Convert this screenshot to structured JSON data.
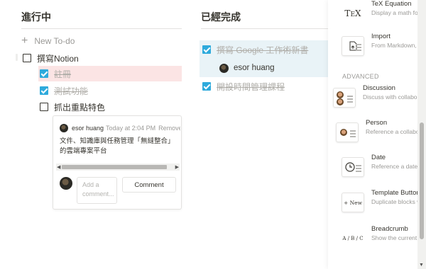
{
  "board": {
    "in_progress": {
      "title": "進行中",
      "new_todo": "New To-do",
      "items": [
        {
          "label": "撰寫Notion",
          "checked": false
        },
        {
          "label": "註冊",
          "checked": true
        },
        {
          "label": "測試功能",
          "checked": true
        },
        {
          "label": "抓出重點特色",
          "checked": false
        }
      ]
    },
    "completed": {
      "title": "已經完成",
      "items": [
        {
          "label": "撰寫 Google 工作術新書",
          "checked": true
        },
        {
          "label": "開設時間管理課程",
          "checked": true
        }
      ],
      "assignee": "esor huang"
    }
  },
  "comment": {
    "author": "esor huang",
    "time": "Today at 2:04 PM",
    "remove": "Remove",
    "text": "文件、知識庫與任務管理「無縫整合」的雲端專案平台",
    "input_placeholder": "Add a comment...",
    "button": "Comment"
  },
  "blocks_panel": {
    "section_advanced": "ADVANCED",
    "items": [
      {
        "title": "TeX Equation",
        "desc": "Display a math formula",
        "icon": "tex-icon",
        "glyph": "TEX"
      },
      {
        "title": "Import",
        "desc": "From Markdown, Word, or HTML",
        "icon": "import-icon"
      },
      {
        "title": "Discussion",
        "desc": "Discuss with collaborators",
        "icon": "discussion-icon"
      },
      {
        "title": "Person",
        "desc": "Reference a collaborator",
        "icon": "person-icon"
      },
      {
        "title": "Date",
        "desc": "Reference a date",
        "icon": "clock-icon"
      },
      {
        "title": "Template Button",
        "desc": "Duplicate blocks with a click",
        "icon": "template-button-icon",
        "glyph": "+ New"
      },
      {
        "title": "Breadcrumb",
        "desc": "Show the current page location",
        "icon": "breadcrumb-icon",
        "glyph": "A / B / C"
      }
    ]
  }
}
